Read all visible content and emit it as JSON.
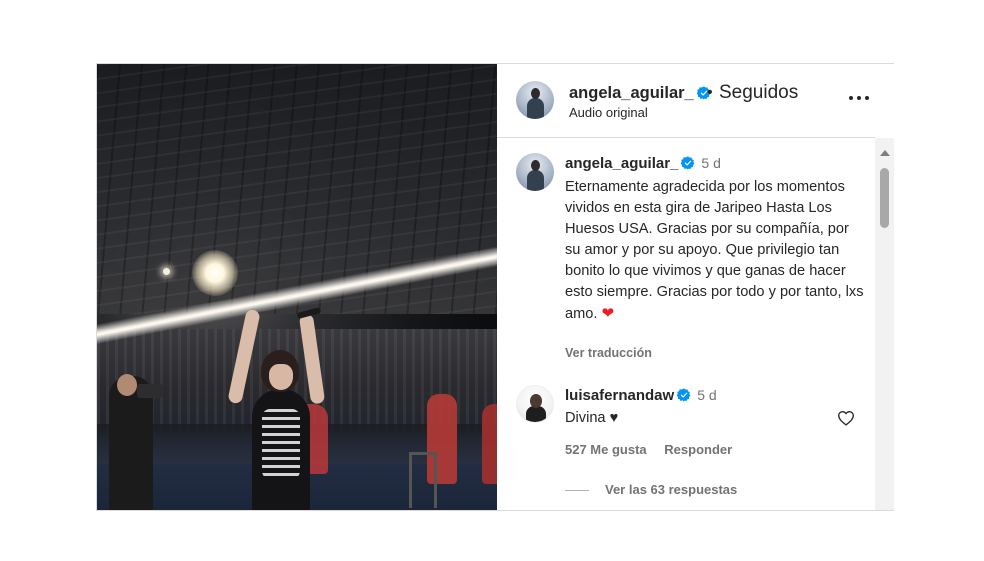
{
  "header": {
    "username": "angela_aguilar_",
    "separator": "•",
    "follow_status": "Seguidos",
    "subtitle": "Audio original"
  },
  "caption": {
    "username": "angela_aguilar_",
    "time": "5 d",
    "text": "Eternamente agradecida por los momentos vividos en esta gira de Jaripeo Hasta Los Huesos USA. Gracias por su compañía, por su amor y por su apoyo. Que privilegio tan bonito lo que vivimos y que ganas de hacer esto siempre. Gracias por todo y por tanto, lxs amo.",
    "heart": "❤",
    "translate": "Ver traducción"
  },
  "comment": {
    "username": "luisafernandaw",
    "time": "5 d",
    "text": "Divina ♥",
    "likes": "527 Me gusta",
    "reply": "Responder",
    "view_replies": "Ver las 63 respuestas"
  },
  "icons": {
    "verified": "verified-badge-icon",
    "more": "more-options-icon",
    "like": "heart-outline-icon",
    "scroll_up": "scroll-up-arrow-icon"
  },
  "colors": {
    "verified_blue": "#0095f6",
    "text_primary": "#262626",
    "text_secondary": "#737373",
    "heart_red": "#ed1c24",
    "divider": "#dbdbdb"
  }
}
